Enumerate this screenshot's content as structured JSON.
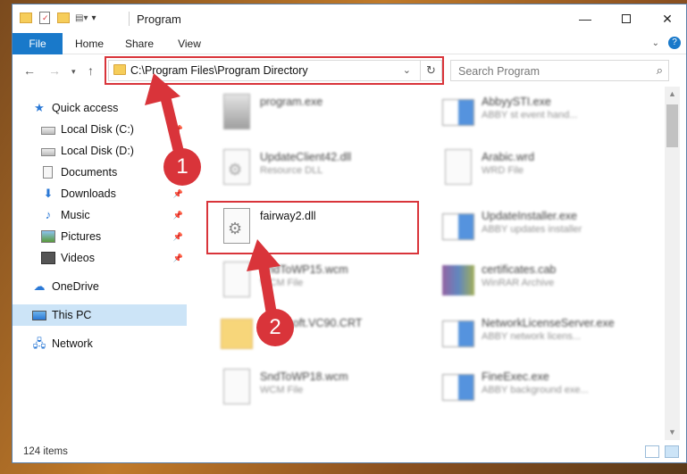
{
  "window": {
    "title": "Program"
  },
  "ribbon": {
    "tabs": [
      "File",
      "Home",
      "Share",
      "View"
    ]
  },
  "address": {
    "path": "C:\\Program Files\\Program Directory"
  },
  "search": {
    "placeholder": "Search Program"
  },
  "sidebar": {
    "items": [
      {
        "label": "Quick access",
        "icon": "star-icon",
        "pinned": false
      },
      {
        "label": "Local Disk (C:)",
        "icon": "drive-icon",
        "pinned": true
      },
      {
        "label": "Local Disk (D:)",
        "icon": "drive-icon",
        "pinned": true
      },
      {
        "label": "Documents",
        "icon": "document-icon",
        "pinned": true
      },
      {
        "label": "Downloads",
        "icon": "download-icon",
        "pinned": true
      },
      {
        "label": "Music",
        "icon": "music-icon",
        "pinned": true
      },
      {
        "label": "Pictures",
        "icon": "picture-icon",
        "pinned": true
      },
      {
        "label": "Videos",
        "icon": "video-icon",
        "pinned": true
      },
      {
        "label": "OneDrive",
        "icon": "cloud-icon",
        "pinned": false
      },
      {
        "label": "This PC",
        "icon": "computer-icon",
        "pinned": false,
        "selected": true
      },
      {
        "label": "Network",
        "icon": "network-icon",
        "pinned": false
      }
    ]
  },
  "files": [
    {
      "name": "program.exe",
      "type": "",
      "icon": "exe-icon"
    },
    {
      "name": "AbbyySTI.exe",
      "type": "ABBY st event hand...",
      "icon": "app-window-icon"
    },
    {
      "name": "UpdateClient42.dll",
      "type": "Resource DLL",
      "icon": "dll-icon"
    },
    {
      "name": "Arabic.wrd",
      "type": "WRD File",
      "icon": "blank-file-icon"
    },
    {
      "name": "fairway2.dll",
      "type": "",
      "icon": "dll-icon"
    },
    {
      "name": "UpdateInstaller.exe",
      "type": "ABBY updates installer",
      "icon": "app-window-icon"
    },
    {
      "name": "SndToWP15.wcm",
      "type": "WCM File",
      "icon": "blank-file-icon"
    },
    {
      "name": "certificates.cab",
      "type": "WinRAR Archive",
      "icon": "archive-icon"
    },
    {
      "name": "Microsoft.VC90.CRT",
      "type": "",
      "icon": "folder-icon"
    },
    {
      "name": "NetworkLicenseServer.exe",
      "type": "ABBY network licens...",
      "icon": "app-window-icon"
    },
    {
      "name": "SndToWP18.wcm",
      "type": "WCM File",
      "icon": "blank-file-icon"
    },
    {
      "name": "FineExec.exe",
      "type": "ABBY background exe...",
      "icon": "app-window-icon"
    }
  ],
  "status": {
    "item_count": "124 items"
  },
  "annotations": {
    "step1": "1",
    "step2": "2"
  },
  "colors": {
    "accent": "#1979ca",
    "highlight": "#d9343a",
    "selected": "#cce4f7"
  }
}
